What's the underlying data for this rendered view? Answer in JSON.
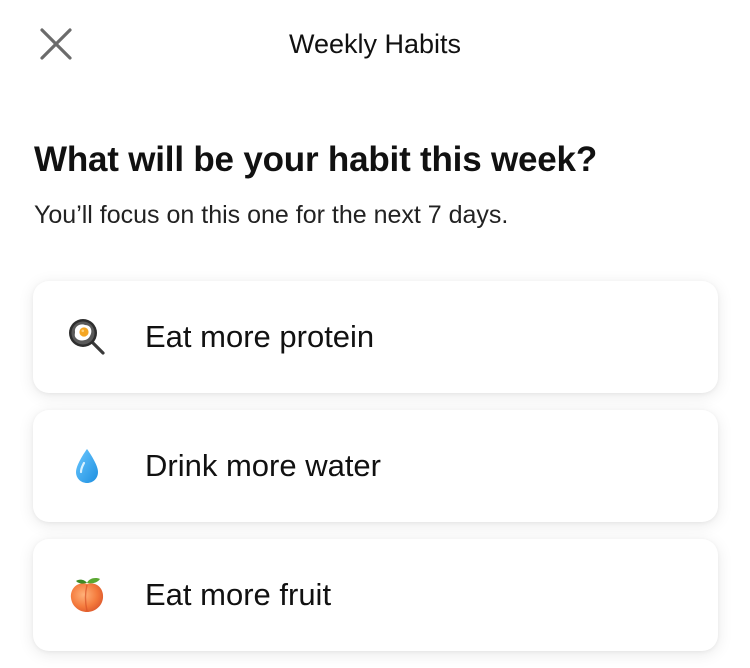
{
  "header": {
    "title": "Weekly Habits",
    "close_icon": "close-icon"
  },
  "prompt": {
    "question": "What will be your habit this week?",
    "subtitle": "You’ll focus on this one for the next 7 days."
  },
  "options": [
    {
      "label": "Eat more protein",
      "icon": "fried-egg-pan-icon"
    },
    {
      "label": "Drink more water",
      "icon": "water-droplet-icon"
    },
    {
      "label": "Eat more fruit",
      "icon": "peach-icon"
    }
  ],
  "colors": {
    "text": "#111111",
    "card_background": "#ffffff",
    "close_icon": "#6b6b6b",
    "droplet": "#2aa6ee",
    "peach": "#f47a3c"
  }
}
